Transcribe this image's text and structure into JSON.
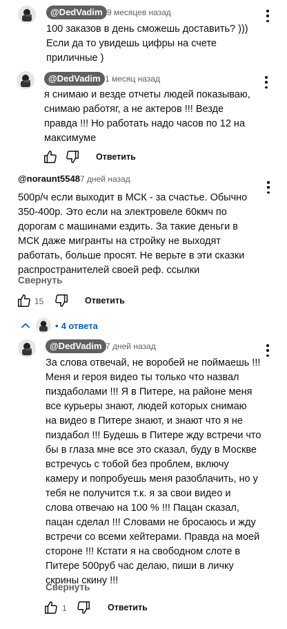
{
  "comments": [
    {
      "author": "@DedVadim",
      "time": "9 месяцев назад",
      "text": "100 заказов в день сможешь доставить? )))\nЕсли да то увидешь цифры на счете\nприличные )"
    },
    {
      "author": "@DedVadim",
      "time": "1 месяц назад",
      "text": "я снимаю и везде отчеты людей показываю,\nснимаю работяг, а не актеров !!! Везде\nправда !!! Но работать надо часов по 12 на\nмаксимуме",
      "reply_label": "Ответить"
    },
    {
      "author": "@noraunt5548",
      "time": "7 дней назад",
      "text": "500р/ч если выходит в МСК - за счастье. Обычно\n350-400р. Это если на электровеле 60кмч по\nдорогам с машинами ездить. За такие деньги в\nМСК даже мигранты на стройку не выходят\nработать, больше просят. Не верьте в эти сказки\nраспространителей своей реф. ссылки",
      "collapse_label": "Свернуть",
      "likes": "15",
      "reply_label": "Ответить",
      "replies_count_label": "4 ответа"
    },
    {
      "author": "@DedVadim",
      "time": "7 дней назад",
      "text": "За слова отвечай, не воробей не поймаешь !!!\nМеня и героя видео ты только что назвал\nпиздаболами !!! Я в Питере, на районе меня\nвсе курьеры знают, людей которых снимаю\nна видео в Питере знают, и знают что я не\nпиздабол !!! Будешь в Питере жду встречи что\nбы в глаза мне все это сказал, буду в Москве\nвстречусь с тобой без проблем, включу\nкамеру и попробуешь меня разоблачить, но у\nтебя не получится т.к. я за свои видео и\nслова отвечаю на 100 % !!! Пацан сказал,\nпацан сделал !!! Словами не бросаюсь и жду\nвстречи со всеми хейтерами. Правда на моей\nстороне !!! Кстати я на свободном слоте в\nПитере 500руб час делаю, пиши в личку\nскрины скину !!!",
      "collapse_label": "Свернуть",
      "likes": "1",
      "reply_label": "Ответить"
    }
  ]
}
